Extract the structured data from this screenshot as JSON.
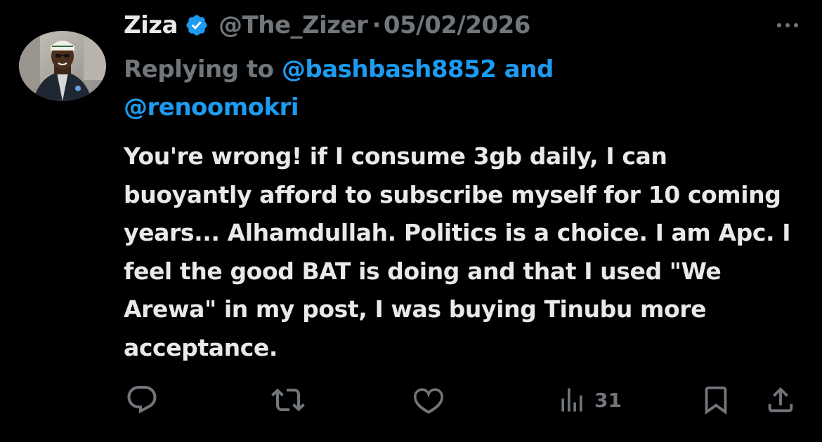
{
  "author": {
    "name": "Ziza",
    "handle": "@The_Zizer",
    "separator": "·",
    "date": "05/02/2026",
    "verified": true
  },
  "reply": {
    "prefix": "Replying to ",
    "mention1": "@bashbash8852",
    "joiner": " and",
    "mention2": "@renoomokri"
  },
  "tweet": {
    "text": "You're wrong! if I consume 3gb daily, I can buoyantly afford to subscribe myself for 10 coming years... Alhamdullah. Politics is a choice. I am Apc. I feel the good BAT is doing and that I used \"We Arewa\" in my post, I was buying Tinubu more acceptance."
  },
  "actions": {
    "views_count": "31"
  },
  "icons": {
    "more": "more-horizontal-icon",
    "verified": "verified-badge-icon",
    "reply": "reply-bubble-icon",
    "retweet": "retweet-icon",
    "like": "heart-icon",
    "views": "views-bar-icon",
    "bookmark": "bookmark-icon",
    "share": "share-icon"
  },
  "colors": {
    "background": "#000000",
    "text": "#e7e9ea",
    "muted": "#71767b",
    "accent": "#1d9bf0"
  }
}
